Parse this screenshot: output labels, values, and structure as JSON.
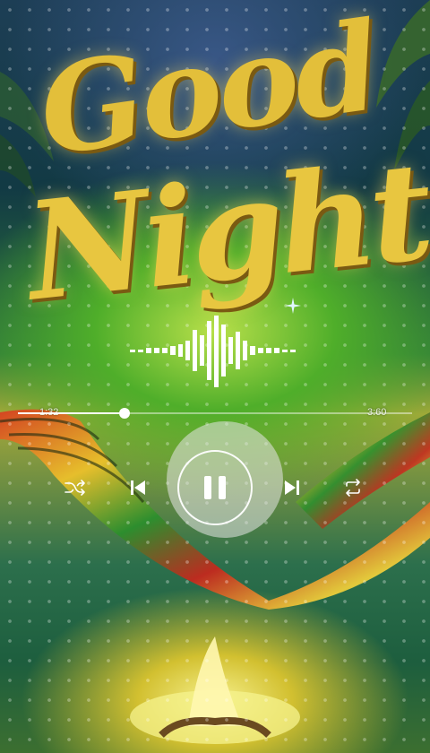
{
  "artwork": {
    "title_line1": "Good",
    "title_line2": "Night"
  },
  "player": {
    "current_time": "1:32",
    "total_time": "3:60",
    "progress": 0.27,
    "state": "playing"
  },
  "controls": {
    "shuffle_icon": "shuffle-icon",
    "previous_icon": "skip-previous-icon",
    "pause_icon": "pause-icon",
    "next_icon": "skip-next-icon",
    "repeat_icon": "repeat-icon"
  },
  "colors": {
    "title_gold": "#e3bf3a",
    "control_white": "#ffffff"
  }
}
